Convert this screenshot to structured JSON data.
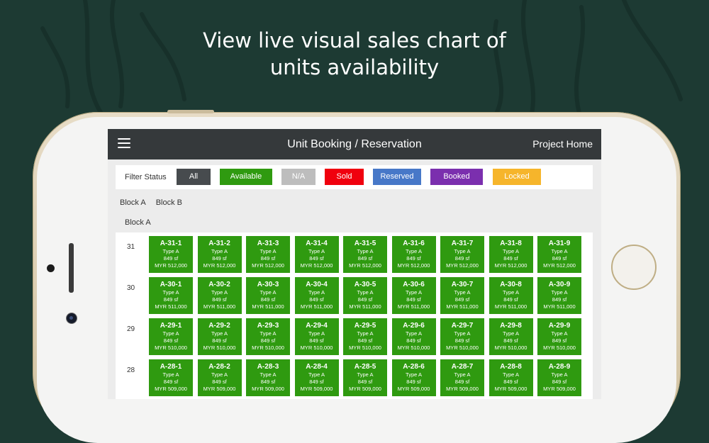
{
  "headline": {
    "line1": "View live visual sales chart of",
    "line2": "units availability"
  },
  "app": {
    "title": "Unit Booking / Reservation",
    "project_home": "Project Home",
    "menu_icon": "hamburger-menu-icon"
  },
  "filter": {
    "label": "Filter Status",
    "buttons": [
      {
        "label": "All",
        "color": "#474b4e"
      },
      {
        "label": "Available",
        "color": "#2f9a10"
      },
      {
        "label": "N/A",
        "color": "#bdbdbd"
      },
      {
        "label": "Sold",
        "color": "#f0000e"
      },
      {
        "label": "Reserved",
        "color": "#4778c8"
      },
      {
        "label": "Booked",
        "color": "#7b2fae"
      },
      {
        "label": "Locked",
        "color": "#f6b52b"
      }
    ]
  },
  "blocks": {
    "tabs": [
      "Block A",
      "Block B"
    ],
    "current": "Block A"
  },
  "unit_available_color": "#2f9a10",
  "floors": [
    {
      "floor": "31",
      "units": [
        {
          "code": "A-31-1",
          "type": "Type A",
          "size": "849 sf",
          "price": "MYR 512,000"
        },
        {
          "code": "A-31-2",
          "type": "Type A",
          "size": "849 sf",
          "price": "MYR 512,000"
        },
        {
          "code": "A-31-3",
          "type": "Type A",
          "size": "849 sf",
          "price": "MYR 512,000"
        },
        {
          "code": "A-31-4",
          "type": "Type A",
          "size": "849 sf",
          "price": "MYR 512,000"
        },
        {
          "code": "A-31-5",
          "type": "Type A",
          "size": "849 sf",
          "price": "MYR 512,000"
        },
        {
          "code": "A-31-6",
          "type": "Type A",
          "size": "849 sf",
          "price": "MYR 512,000"
        },
        {
          "code": "A-31-7",
          "type": "Type A",
          "size": "849 sf",
          "price": "MYR 512,000"
        },
        {
          "code": "A-31-8",
          "type": "Type A",
          "size": "849 sf",
          "price": "MYR 512,000"
        },
        {
          "code": "A-31-9",
          "type": "Type A",
          "size": "849 sf",
          "price": "MYR 512,000"
        }
      ]
    },
    {
      "floor": "30",
      "units": [
        {
          "code": "A-30-1",
          "type": "Type A",
          "size": "849 sf",
          "price": "MYR 511,000"
        },
        {
          "code": "A-30-2",
          "type": "Type A",
          "size": "849 sf",
          "price": "MYR 511,000"
        },
        {
          "code": "A-30-3",
          "type": "Type A",
          "size": "849 sf",
          "price": "MYR 511,000"
        },
        {
          "code": "A-30-4",
          "type": "Type A",
          "size": "849 sf",
          "price": "MYR 511,000"
        },
        {
          "code": "A-30-5",
          "type": "Type A",
          "size": "849 sf",
          "price": "MYR 511,000"
        },
        {
          "code": "A-30-6",
          "type": "Type A",
          "size": "849 sf",
          "price": "MYR 511,000"
        },
        {
          "code": "A-30-7",
          "type": "Type A",
          "size": "849 sf",
          "price": "MYR 511,000"
        },
        {
          "code": "A-30-8",
          "type": "Type A",
          "size": "849 sf",
          "price": "MYR 511,000"
        },
        {
          "code": "A-30-9",
          "type": "Type A",
          "size": "849 sf",
          "price": "MYR 511,000"
        }
      ]
    },
    {
      "floor": "29",
      "units": [
        {
          "code": "A-29-1",
          "type": "Type A",
          "size": "849 sf",
          "price": "MYR 510,000"
        },
        {
          "code": "A-29-2",
          "type": "Type A",
          "size": "849 sf",
          "price": "MYR 510,000"
        },
        {
          "code": "A-29-3",
          "type": "Type A",
          "size": "849 sf",
          "price": "MYR 510,000"
        },
        {
          "code": "A-29-4",
          "type": "Type A",
          "size": "849 sf",
          "price": "MYR 510,000"
        },
        {
          "code": "A-29-5",
          "type": "Type A",
          "size": "849 sf",
          "price": "MYR 510,000"
        },
        {
          "code": "A-29-6",
          "type": "Type A",
          "size": "849 sf",
          "price": "MYR 510,000"
        },
        {
          "code": "A-29-7",
          "type": "Type A",
          "size": "849 sf",
          "price": "MYR 510,000"
        },
        {
          "code": "A-29-8",
          "type": "Type A",
          "size": "849 sf",
          "price": "MYR 510,000"
        },
        {
          "code": "A-29-9",
          "type": "Type A",
          "size": "849 sf",
          "price": "MYR 510,000"
        }
      ]
    },
    {
      "floor": "28",
      "units": [
        {
          "code": "A-28-1",
          "type": "Type A",
          "size": "849 sf",
          "price": "MYR 509,000"
        },
        {
          "code": "A-28-2",
          "type": "Type A",
          "size": "849 sf",
          "price": "MYR 509,000"
        },
        {
          "code": "A-28-3",
          "type": "Type A",
          "size": "849 sf",
          "price": "MYR 509,000"
        },
        {
          "code": "A-28-4",
          "type": "Type A",
          "size": "849 sf",
          "price": "MYR 509,000"
        },
        {
          "code": "A-28-5",
          "type": "Type A",
          "size": "849 sf",
          "price": "MYR 509,000"
        },
        {
          "code": "A-28-6",
          "type": "Type A",
          "size": "849 sf",
          "price": "MYR 509,000"
        },
        {
          "code": "A-28-7",
          "type": "Type A",
          "size": "849 sf",
          "price": "MYR 509,000"
        },
        {
          "code": "A-28-8",
          "type": "Type A",
          "size": "849 sf",
          "price": "MYR 509,000"
        },
        {
          "code": "A-28-9",
          "type": "Type A",
          "size": "849 sf",
          "price": "MYR 509,000"
        }
      ]
    }
  ]
}
